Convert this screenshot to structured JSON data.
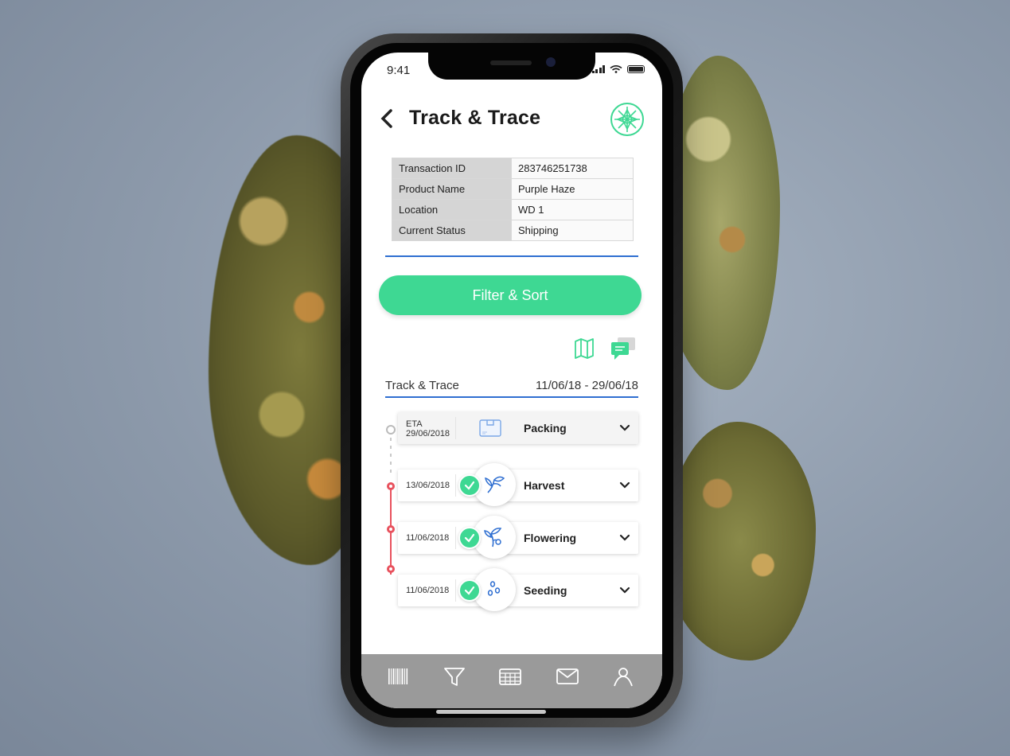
{
  "status_bar": {
    "time": "9:41"
  },
  "header": {
    "title": "Track & Trace"
  },
  "transaction": {
    "rows": [
      {
        "key": "Transaction ID",
        "value": "283746251738"
      },
      {
        "key": "Product Name",
        "value": "Purple Haze"
      },
      {
        "key": "Location",
        "value": "WD 1"
      },
      {
        "key": "Current Status",
        "value": "Shipping"
      }
    ]
  },
  "filter_button": {
    "label": "Filter & Sort"
  },
  "section": {
    "label": "Track & Trace",
    "range": "11/06/18 - 29/06/18"
  },
  "timeline": [
    {
      "date_line1": "ETA",
      "date_line2": "29/06/2018",
      "stage": "Packing",
      "completed": false,
      "icon": "box-icon"
    },
    {
      "date": "13/06/2018",
      "stage": "Harvest",
      "completed": true,
      "icon": "sprout-icon"
    },
    {
      "date": "11/06/2018",
      "stage": "Flowering",
      "completed": true,
      "icon": "flower-plant-icon"
    },
    {
      "date": "11/06/2018",
      "stage": "Seeding",
      "completed": true,
      "icon": "seeds-icon"
    }
  ],
  "tabbar": [
    "barcode-icon",
    "filter-icon",
    "calendar-icon",
    "mail-icon",
    "profile-icon"
  ],
  "colors": {
    "accent_green": "#3ed893",
    "accent_blue": "#2f6fd1",
    "timeline_red": "#e8515d",
    "tabbar": "#9a9a9a"
  }
}
